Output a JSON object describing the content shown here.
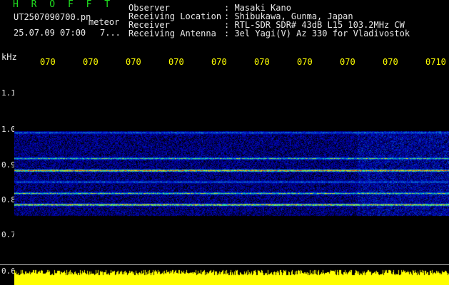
{
  "header": {
    "title": "H R O F F T",
    "filename": "UT2507090700.pn",
    "mode": "meteor",
    "datetime": "25.07.09 07:00",
    "count": "7..."
  },
  "info": {
    "observer_key": "Observer",
    "observer_val": ": Masaki Kano",
    "location_key": "Receiving Location",
    "location_val": ": Shibukawa, Gunma, Japan",
    "receiver_key": "Receiver",
    "receiver_val": ": RTL-SDR SDR# 43dB L15 103.2MHz CW",
    "antenna_key": "Receiving Antenna",
    "antenna_val": ": 3el Yagi(V) Az 330 for Vladivostok"
  },
  "axis": {
    "unit": "kHz",
    "yticks": [
      "1.1",
      "1.0",
      "0.9",
      "0.8",
      "0.7",
      "0.6"
    ],
    "xticks": [
      "070",
      "070",
      "070",
      "070",
      "070",
      "070",
      "070",
      "070",
      "070",
      "0710"
    ]
  },
  "colors": {
    "background": "#000000",
    "text": "#e8e8e8",
    "title": "#20e020",
    "xtick": "#ffff00",
    "signal_bar": "#ffff00"
  }
}
